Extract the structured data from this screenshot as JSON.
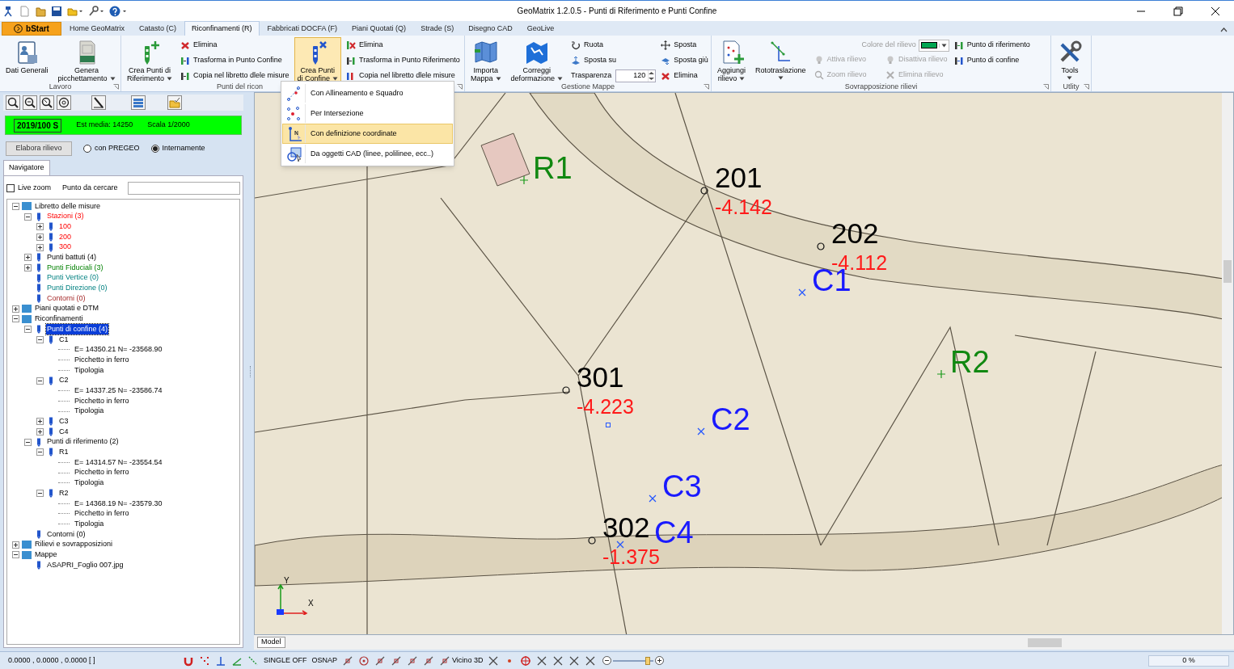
{
  "window": {
    "title": "GeoMatrix 1.2.0.5 - Punti di Riferimento e Punti Confine"
  },
  "tabs": [
    {
      "label": "bStart",
      "kind": "start",
      "selected": false
    },
    {
      "label": "Home GeoMatrix",
      "kind": "tab",
      "selected": false
    },
    {
      "label": "Catasto (C)",
      "kind": "tab",
      "selected": false
    },
    {
      "label": "Riconfinamenti (R)",
      "kind": "tab",
      "selected": true
    },
    {
      "label": "Fabbricati DOCFA (F)",
      "kind": "tab",
      "selected": false
    },
    {
      "label": "Piani Quotati (Q)",
      "kind": "tab",
      "selected": false
    },
    {
      "label": "Strade (S)",
      "kind": "tab",
      "selected": false
    },
    {
      "label": "Disegno CAD",
      "kind": "tab",
      "selected": false
    },
    {
      "label": "GeoLive",
      "kind": "tab",
      "selected": false
    }
  ],
  "ribbon": {
    "groups": [
      {
        "label": "Lavoro",
        "controls": [
          {
            "kind": "large",
            "lines": [
              "Dati Generali"
            ],
            "dropdown": false,
            "expanded": false
          },
          {
            "kind": "large",
            "lines": [
              "Genera",
              "picchettamento"
            ],
            "dropdown": true,
            "expanded": false
          }
        ]
      },
      {
        "label": "Punti del ricon",
        "controls": [
          {
            "kind": "large",
            "lines": [
              "Crea Punti di",
              "Riferimento"
            ],
            "dropdown": true,
            "expanded": false
          },
          {
            "kind": "stack",
            "items": [
              {
                "kind": "button",
                "label": "Elimina",
                "disabled": false
              },
              {
                "kind": "button",
                "label": "Trasforma in Punto Confine",
                "disabled": false
              },
              {
                "kind": "button",
                "label": "Copia nel libretto dlele misure",
                "disabled": false
              }
            ]
          },
          {
            "kind": "large",
            "lines": [
              "Crea Punti",
              "di Confine"
            ],
            "dropdown": true,
            "expanded": true
          },
          {
            "kind": "stack",
            "items": [
              {
                "kind": "button",
                "label": "Elimina",
                "disabled": false
              },
              {
                "kind": "button",
                "label": "Trasforma in Punto Riferimento",
                "disabled": false
              },
              {
                "kind": "button",
                "label": "Copia nel libretto dlele misure",
                "disabled": false
              }
            ]
          }
        ]
      },
      {
        "label": "Gestione Mappe",
        "controls": [
          {
            "kind": "large",
            "lines": [
              "Importa",
              "Mappa"
            ],
            "dropdown": true,
            "expanded": false
          },
          {
            "kind": "large",
            "lines": [
              "Correggi",
              "deformazione"
            ],
            "dropdown": true,
            "expanded": false
          },
          {
            "kind": "stack",
            "items": [
              {
                "kind": "button",
                "label": "Ruota",
                "disabled": false
              },
              {
                "kind": "button",
                "label": "Sposta su",
                "disabled": false
              },
              {
                "kind": "spin",
                "label": "Trasparenza",
                "value": "120",
                "disabled": false
              }
            ]
          },
          {
            "kind": "stack",
            "items": [
              {
                "kind": "button",
                "label": "Sposta",
                "disabled": false
              },
              {
                "kind": "button",
                "label": "Sposta giù",
                "disabled": false
              },
              {
                "kind": "button",
                "label": "Elimina",
                "disabled": false
              }
            ]
          }
        ]
      },
      {
        "label": "Sovrapposizione rilievi",
        "controls": [
          {
            "kind": "large",
            "lines": [
              "Aggiungi",
              "rilievo"
            ],
            "dropdown": true,
            "expanded": false
          },
          {
            "kind": "large",
            "lines": [
              "Rototraslazione"
            ],
            "dropdown": true,
            "expanded": false
          },
          {
            "kind": "grid",
            "color_label": "Colore del rilievo",
            "color": "#00a651",
            "items": [
              {
                "kind": "button",
                "label": "Attiva rilievo",
                "disabled": true
              },
              {
                "kind": "button",
                "label": "Disattiva rilievo",
                "disabled": true
              },
              {
                "kind": "button",
                "label": "Zoom rilievo",
                "disabled": true
              },
              {
                "kind": "button",
                "label": "Elimina rilievo",
                "disabled": true
              }
            ]
          },
          {
            "kind": "stack",
            "items": [
              {
                "kind": "button",
                "label": "Punto di riferimento",
                "disabled": false
              },
              {
                "kind": "button",
                "label": "Punto di confine",
                "disabled": false
              }
            ]
          }
        ]
      },
      {
        "label": "Utlity",
        "controls": [
          {
            "kind": "large",
            "lines": [
              "Tools"
            ],
            "dropdown": true,
            "expanded": false
          }
        ]
      }
    ]
  },
  "dropdown_menu": [
    {
      "label": "Con Allineamento e Squadro",
      "selected": false
    },
    {
      "label": "Per Intersezione",
      "selected": false
    },
    {
      "label": "Con definizione coordinate",
      "selected": true
    },
    {
      "label": "Da oggetti CAD (linee, polilinee, ecc..)",
      "selected": false
    }
  ],
  "survey_bar": {
    "code": "2019/100 S",
    "est": "Est media: 14250",
    "scale": "Scala 1/2000"
  },
  "process_button": "Elabora rilievo",
  "process_options": [
    {
      "label": "con PREGEO",
      "selected": false
    },
    {
      "label": "Internamente",
      "selected": true
    }
  ],
  "navigator": {
    "tab": "Navigatore",
    "live_zoom": {
      "label": "Live zoom",
      "checked": false
    },
    "search_label": "Punto da cercare",
    "tree": [
      {
        "label": "Libretto delle misure",
        "kind": "plain",
        "selected": false,
        "expanded": true,
        "children": [
          {
            "label": "Stazioni (3)",
            "kind": "station",
            "selected": false,
            "expanded": true,
            "children": [
              {
                "label": "100",
                "kind": "station",
                "selected": false,
                "expanded": false
              },
              {
                "label": "200",
                "kind": "station",
                "selected": false,
                "expanded": false
              },
              {
                "label": "300",
                "kind": "station",
                "selected": false,
                "expanded": false
              }
            ]
          },
          {
            "label": "Punti battuti (4)",
            "kind": "plain",
            "selected": false,
            "expanded": false
          },
          {
            "label": "Punti Fiduciali (3)",
            "kind": "fiducial",
            "selected": false,
            "expanded": false
          },
          {
            "label": "Punti Vertice (0)",
            "kind": "vertex",
            "selected": false
          },
          {
            "label": "Punti Direzione (0)",
            "kind": "vertex",
            "selected": false
          },
          {
            "label": "Contorni (0)",
            "kind": "outline",
            "selected": false
          }
        ]
      },
      {
        "label": "Piani quotati e DTM",
        "kind": "plain",
        "selected": false,
        "expanded": false
      },
      {
        "label": "Riconfinamenti",
        "kind": "plain",
        "selected": false,
        "expanded": true,
        "children": [
          {
            "label": "Punti di confine (4)",
            "kind": "plain",
            "selected": true,
            "expanded": true,
            "children": [
              {
                "label": "C1",
                "kind": "plain",
                "selected": false,
                "expanded": true,
                "children": [
                  {
                    "label": "E= 14350.21 N= -23568.90",
                    "kind": "plain",
                    "selected": false
                  },
                  {
                    "label": "Picchetto in ferro",
                    "kind": "plain",
                    "selected": false
                  },
                  {
                    "label": "Tipologia",
                    "kind": "plain",
                    "selected": false
                  }
                ]
              },
              {
                "label": "C2",
                "kind": "plain",
                "selected": false,
                "expanded": true,
                "children": [
                  {
                    "label": "E= 14337.25 N= -23586.74",
                    "kind": "plain",
                    "selected": false
                  },
                  {
                    "label": "Picchetto in ferro",
                    "kind": "plain",
                    "selected": false
                  },
                  {
                    "label": "Tipologia",
                    "kind": "plain",
                    "selected": false
                  }
                ]
              },
              {
                "label": "C3",
                "kind": "plain",
                "selected": false,
                "expanded": false
              },
              {
                "label": "C4",
                "kind": "plain",
                "selected": false,
                "expanded": false
              }
            ]
          },
          {
            "label": "Punti di riferimento (2)",
            "kind": "plain",
            "selected": false,
            "expanded": true,
            "children": [
              {
                "label": "R1",
                "kind": "plain",
                "selected": false,
                "expanded": true,
                "children": [
                  {
                    "label": "E= 14314.57 N= -23554.54",
                    "kind": "plain",
                    "selected": false
                  },
                  {
                    "label": "Picchetto in ferro",
                    "kind": "plain",
                    "selected": false
                  },
                  {
                    "label": "Tipologia",
                    "kind": "plain",
                    "selected": false
                  }
                ]
              },
              {
                "label": "R2",
                "kind": "plain",
                "selected": false,
                "expanded": true,
                "children": [
                  {
                    "label": "E= 14368.19 N= -23579.30",
                    "kind": "plain",
                    "selected": false
                  },
                  {
                    "label": "Picchetto in ferro",
                    "kind": "plain",
                    "selected": false
                  },
                  {
                    "label": "Tipologia",
                    "kind": "plain",
                    "selected": false
                  }
                ]
              }
            ]
          },
          {
            "label": "Contorni (0)",
            "kind": "plain",
            "selected": false
          }
        ]
      },
      {
        "label": "Rilievi e sovrapposizioni",
        "kind": "plain",
        "selected": false,
        "expanded": false
      },
      {
        "label": "Mappe",
        "kind": "plain",
        "selected": false,
        "expanded": true,
        "children": [
          {
            "label": "ASAPRI_Foglio 007.jpg",
            "kind": "plain",
            "selected": false
          }
        ]
      }
    ]
  },
  "map": {
    "kind": "picture",
    "stations": [
      {
        "label": "201",
        "value": "-4.142"
      },
      {
        "label": "202",
        "value": "-4.112"
      },
      {
        "label": "301",
        "value": "-4.223"
      },
      {
        "label": "302",
        "value": "-1.375"
      }
    ],
    "boundary_points": [
      {
        "label": "C1"
      },
      {
        "label": "C2"
      },
      {
        "label": "C3"
      },
      {
        "label": "C4"
      }
    ],
    "reference_points": [
      {
        "label": "R1"
      },
      {
        "label": "R2"
      }
    ],
    "axes": {
      "x": "X",
      "y": "Y"
    },
    "layout_tab": "Model"
  },
  "status_bar": {
    "coordinates": "0.0000 , 0.0000 , 0.0000 [ ]",
    "snap_texts": [
      "SINGLE OFF",
      "OSNAP",
      "Vicino 3D"
    ],
    "zoom": {
      "level": 0.85
    },
    "progress": {
      "text": "0 %",
      "level": 0
    }
  }
}
